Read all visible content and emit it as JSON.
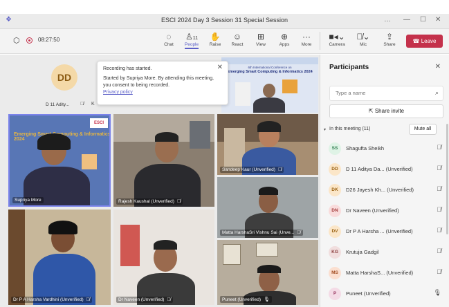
{
  "window": {
    "title": "ESCI 2024 Day 3 Session 31 Special Session",
    "more_glyph": "…",
    "minimize_glyph": "—",
    "maximize_glyph": "☐",
    "close_glyph": "✕"
  },
  "meeting": {
    "timer": "08:27:50"
  },
  "toolbar": {
    "chat": "Chat",
    "people": "People",
    "people_count": "11",
    "raise": "Raise",
    "react": "React",
    "view": "View",
    "apps": "Apps",
    "more": "More",
    "camera": "Camera",
    "mic": "Mic",
    "share": "Share",
    "leave": "Leave"
  },
  "toast": {
    "title": "Recording has started.",
    "body": "Started by Supriya More. By attending this meeting, you consent to being recorded.",
    "link": "Privacy policy"
  },
  "self_tile": {
    "initials": "DD",
    "label": "D 11 Adity..."
  },
  "banner": {
    "line1": "6th International Conference on",
    "line2": "Emerging Smart Computing & Informatics 2024"
  },
  "slide": {
    "title": "Emerging Smart Computing & Informatics 2024",
    "side": "ESCI"
  },
  "tiles": [
    {
      "name": "Supriya More"
    },
    {
      "name": "Rajesh Kaushal (Unverified)"
    },
    {
      "name": "Sandeep Kaur (Unverified)"
    },
    {
      "name": "Matta HarshaSri Vishnu Sai (Unve..."
    },
    {
      "name": "Dr P A Harsha Vardhini (Unverified)"
    },
    {
      "name": "Dr Naveen (Unverified)"
    },
    {
      "name": "Puneet (Unverified)"
    }
  ],
  "panel": {
    "title": "Participants",
    "search_placeholder": "Type a name",
    "share_invite": "Share invite",
    "section": "In this meeting (11)",
    "mute_all": "Mute all",
    "participants": [
      {
        "initials": "SS",
        "name": "Shagufta Sheikh",
        "bg": "#dff3e6",
        "fg": "#2e7d4f",
        "mic": "muted"
      },
      {
        "initials": "DD",
        "name": "D 11 Aditya Da... (Unverified)",
        "bg": "#fbe6c8",
        "fg": "#9a6212",
        "mic": "muted"
      },
      {
        "initials": "DK",
        "name": "D26 Jayesh Kh... (Unverified)",
        "bg": "#fbe6c8",
        "fg": "#9a6212",
        "mic": "muted"
      },
      {
        "initials": "DN",
        "name": "Dr Naveen (Unverified)",
        "bg": "#f9dcdc",
        "fg": "#a33a3a",
        "mic": "muted"
      },
      {
        "initials": "DV",
        "name": "Dr P A Harsha ... (Unverified)",
        "bg": "#fbe6c8",
        "fg": "#9a6212",
        "mic": "muted"
      },
      {
        "initials": "KG",
        "name": "Krutuja Gadgil",
        "bg": "#f1dede",
        "fg": "#8a3d3d",
        "mic": "muted"
      },
      {
        "initials": "MS",
        "name": "Matta HarshaS... (Unverified)",
        "bg": "#fbdfd0",
        "fg": "#a34d22",
        "mic": "muted"
      },
      {
        "initials": "P",
        "name": "Puneet (Unverified)",
        "bg": "#f4dbe6",
        "fg": "#9a3a63",
        "mic": "on"
      }
    ]
  }
}
